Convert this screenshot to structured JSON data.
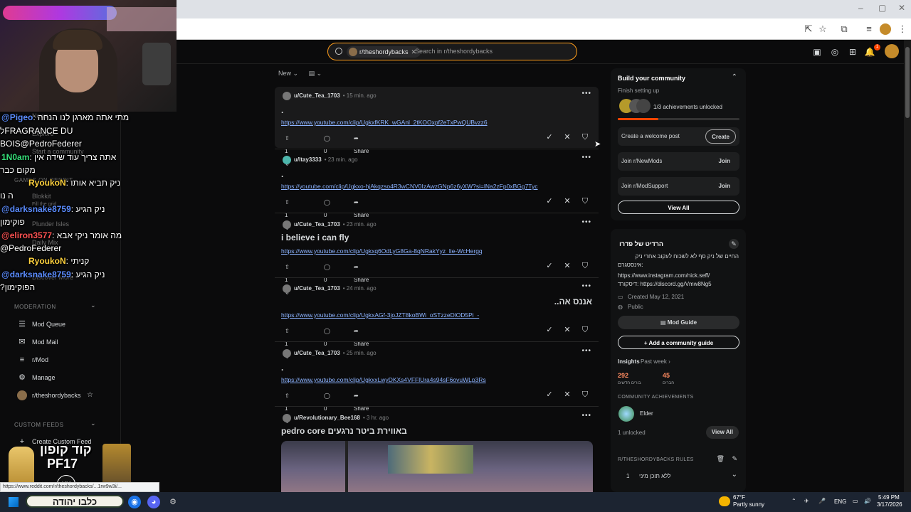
{
  "browser": {
    "window_controls": [
      "–",
      "▢",
      "✕"
    ]
  },
  "header": {
    "search_chip": "r/theshordybacks",
    "search_placeholder": "Search in r/theshordybacks",
    "notification_count": "1"
  },
  "feed": {
    "sort_label": "New",
    "posts": [
      {
        "author": "u/Cute_Tea_1703",
        "time": "• 15 min. ago",
        "title": ".",
        "link": "https://www.youtube.com/clip/UgkxfKRK_wGAnl_2tKOOxpf2eTxPwQUBvzz6",
        "votes": "1",
        "comments": "0",
        "share": "Share"
      },
      {
        "author": "u/Itay3333",
        "time": "• 23 min. ago",
        "title": ".",
        "link": "https://youtube.com/clip/Ugkxo-hjAkqzso4R3wCNV0IzAwzGNp6z6yXW?si=lNa2zFp0xBGg7Tyc",
        "votes": "1",
        "comments": "0",
        "share": "Share"
      },
      {
        "author": "u/Cute_Tea_1703",
        "time": "• 23 min. ago",
        "title": "i believe i can fly",
        "link": "https://www.youtube.com/clip/Ugkxq6OdLyG8Ga-8qNRakYyz_lie-WcHergq",
        "votes": "1",
        "comments": "0",
        "share": "Share"
      },
      {
        "author": "u/Cute_Tea_1703",
        "time": "• 24 min. ago",
        "title": "אננס אה..",
        "link": "https://www.youtube.com/clip/UgkxAGf-3joJZT8koBWi_oSTzzeDlOD5Pi_-",
        "votes": "1",
        "comments": "0",
        "share": "Share"
      },
      {
        "author": "u/Cute_Tea_1703",
        "time": "• 25 min. ago",
        "title": ".",
        "link": "https://www.youtube.com/clip/UgkxxLwyDKXs4VFFlUra4s94sF6ovuWLp3Rs",
        "votes": "1",
        "comments": "0",
        "share": "Share"
      },
      {
        "author": "u/Revolutionary_Bee168",
        "time": "• 3 hr. ago",
        "title": "pedro core באווירת ביטר נרגעים"
      }
    ]
  },
  "sidebar": {
    "moderation_label": "MODERATION",
    "items": [
      "Mod Queue",
      "Mod Mail",
      "r/Mod",
      "Manage",
      "r/theshordybacks"
    ],
    "custom_feeds_label": "CUSTOM FEEDS",
    "create_feed": "Create Custom Feed",
    "faded_items": [
      "News",
      "Explore",
      "Start a community",
      "GAMES ON REDDIT",
      "Blokkit",
      "Fill the grid",
      "Plunder Isles",
      "Daily Mix",
      "Discover More"
    ]
  },
  "chat": [
    {
      "user": "@Pigeo",
      "msg": ": מתי אתה מארגן לנו הנחה"
    },
    {
      "user": "",
      "msg": "לFRAGRANCE DU"
    },
    {
      "user": "",
      "msg": "BOIS@PedroFederer"
    },
    {
      "user": "1N0am",
      "msg": ": אתה צריך עוד שידה אין"
    },
    {
      "user": "",
      "msg": "מקום כבר"
    },
    {
      "user": "RyoukoN",
      "msg": ": ניק תביא אותו"
    },
    {
      "user": "",
      "msg": "ה נו"
    },
    {
      "user": "@darksnake8759",
      "msg": ": ניק הגיע"
    },
    {
      "user": "",
      "msg": "פוקימון"
    },
    {
      "user": "@eliron3577",
      "msg": ": מה אומר ניקי אבא"
    },
    {
      "user": "",
      "msg": "@PedroFederer"
    },
    {
      "user": "RyoukoN",
      "msg": ": קניתי"
    },
    {
      "user": "@darksnake8759",
      "msg": ": ניק הגיע"
    },
    {
      "user": "",
      "msg": "?הפוקימון"
    }
  ],
  "right": {
    "build_title": "Build your community",
    "finish_setup": "Finish setting up",
    "achievements_unlocked": "1/3 achievements unlocked",
    "tasks": [
      {
        "label": "Create a welcome post",
        "button": "Create"
      },
      {
        "label": "Join r/NewMods",
        "button": "Join"
      },
      {
        "label": "Join r/ModSupport",
        "button": "Join"
      }
    ],
    "view_all": "View All",
    "about_title": "הרדיט של פדרו",
    "about_desc1": "החיים של ניק סף לא לשכוח לעקוב אחרי ניק",
    "about_desc2": ":אינסטגרם",
    "about_link1": "https://www.instagram.com/nick.seff/",
    "about_link2": "דיסקורד: https://discord.gg/Vmw8Ng5",
    "created": "Created May 12, 2021",
    "visibility": "Public",
    "mod_guide": "Mod Guide",
    "add_guide": "Add a community guide",
    "insights_label": "Insights",
    "insights_period": "Past week ›",
    "stat1_value": "292",
    "stat1_label": "בורים חדשים",
    "stat2_value": "45",
    "stat2_label": "חברים",
    "achievements_label": "COMMUNITY ACHIEVEMENTS",
    "achievement_name": "Elder",
    "unlocked": "1 unlocked",
    "rules_label": "R/THESHORDYBACKS RULES",
    "rule1_num": "1",
    "rule1": "ללא תוכן מיני"
  },
  "promo": {
    "code": "קוד קופון",
    "code2": "PF17",
    "logo": "KY",
    "banner": "כלבו יהודה",
    "status_url": "https://www.reddit.com/r/theshordybacks/...1rw9w3i/..."
  },
  "taskbar": {
    "weather_temp": "67°F",
    "weather_desc": "Partly sunny",
    "lang": "ENG",
    "time": "5:49 PM",
    "date": "3/17/2026"
  }
}
